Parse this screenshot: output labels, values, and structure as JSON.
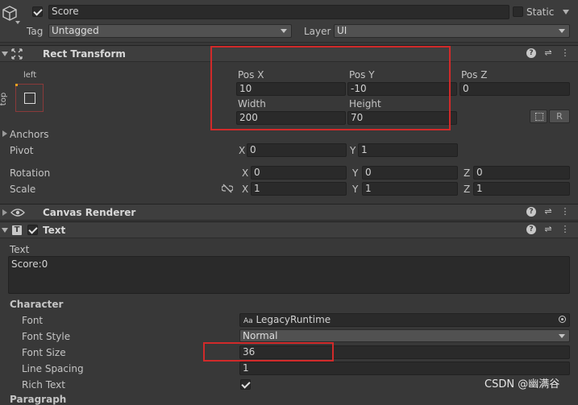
{
  "gameobject": {
    "name": "Score",
    "active": true,
    "static_label": "Static",
    "tag_label": "Tag",
    "tag_value": "Untagged",
    "layer_label": "Layer",
    "layer_value": "UI"
  },
  "rect_transform": {
    "title": "Rect Transform",
    "anchor_preset_h": "left",
    "anchor_preset_v": "top",
    "pos_x_label": "Pos X",
    "pos_x": "10",
    "pos_y_label": "Pos Y",
    "pos_y": "-10",
    "pos_z_label": "Pos Z",
    "pos_z": "0",
    "width_label": "Width",
    "width": "200",
    "height_label": "Height",
    "height": "70",
    "raw_button": "R",
    "anchors_label": "Anchors",
    "pivot_label": "Pivot",
    "pivot_x": "0",
    "pivot_y": "1",
    "rotation_label": "Rotation",
    "rot_x": "0",
    "rot_y": "0",
    "rot_z": "0",
    "scale_label": "Scale",
    "scale_x": "1",
    "scale_y": "1",
    "scale_z": "1",
    "x": "X",
    "y": "Y",
    "z": "Z"
  },
  "canvas_renderer": {
    "title": "Canvas Renderer"
  },
  "text_component": {
    "title": "Text",
    "enabled": true,
    "text_label": "Text",
    "text_value": "Score:0",
    "character_label": "Character",
    "font_label": "Font",
    "font_value": "LegacyRuntime",
    "font_style_label": "Font Style",
    "font_style_value": "Normal",
    "font_size_label": "Font Size",
    "font_size_value": "36",
    "line_spacing_label": "Line Spacing",
    "line_spacing_value": "1",
    "rich_text_label": "Rich Text",
    "rich_text": true,
    "paragraph_label": "Paragraph"
  },
  "watermark": "CSDN @幽满谷",
  "colors": {
    "highlight": "#d12a2a",
    "background": "#383838"
  }
}
